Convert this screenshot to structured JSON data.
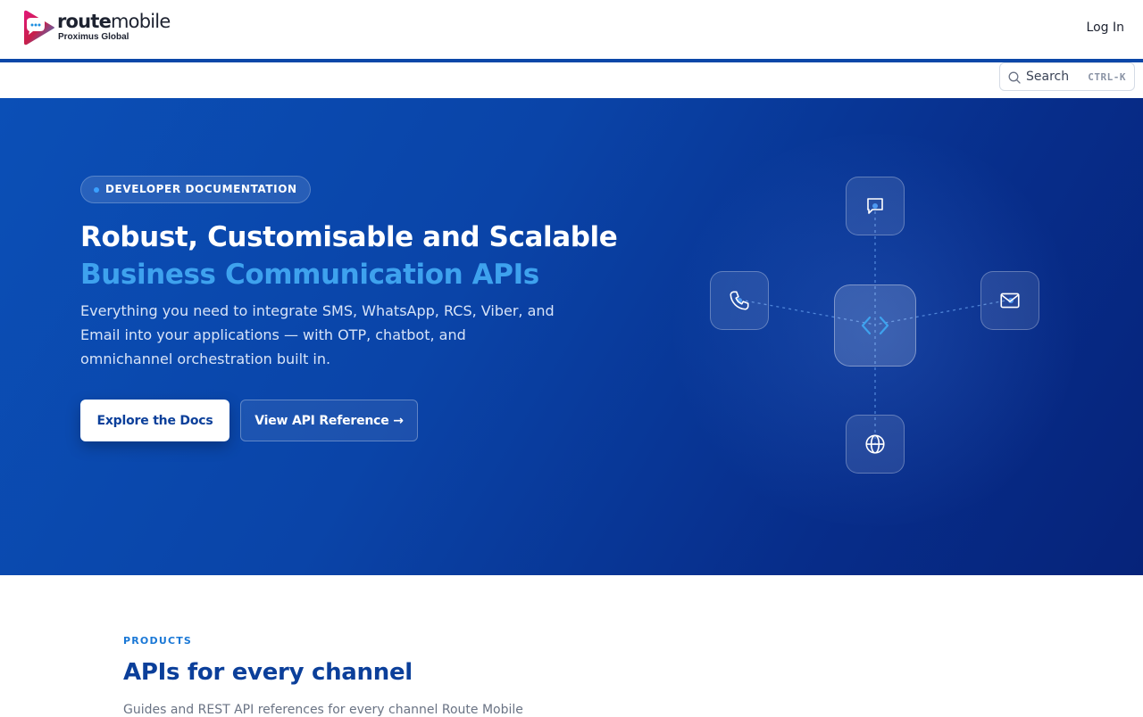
{
  "header": {
    "logo": {
      "word_bold": "route",
      "word_light": "mobile",
      "sub": "Proximus Global"
    },
    "login_label": "Log In"
  },
  "search": {
    "label": "Search",
    "shortcut": "CTRL-K"
  },
  "hero": {
    "badge": "DEVELOPER DOCUMENTATION",
    "title_line1": "Robust, Customisable and Scalable",
    "title_line2": "Business Communication APIs",
    "lede": "Everything you need to integrate SMS, WhatsApp, RCS, Viber, and Email into your applications — with OTP, chatbot, and omnichannel orchestration built in.",
    "primary_button": "Explore the Docs",
    "secondary_button": "View API Reference →",
    "diagram_icons": [
      "chat-icon",
      "phone-icon",
      "code-icon",
      "mail-icon",
      "globe-icon"
    ]
  },
  "products": {
    "eyebrow": "PRODUCTS",
    "title": "APIs for every channel",
    "lede": "Guides and REST API references for every channel Route Mobile"
  },
  "colors": {
    "brand": "#0b47a8",
    "accent": "#3ea2ee",
    "hero_dark": "#06237a"
  }
}
